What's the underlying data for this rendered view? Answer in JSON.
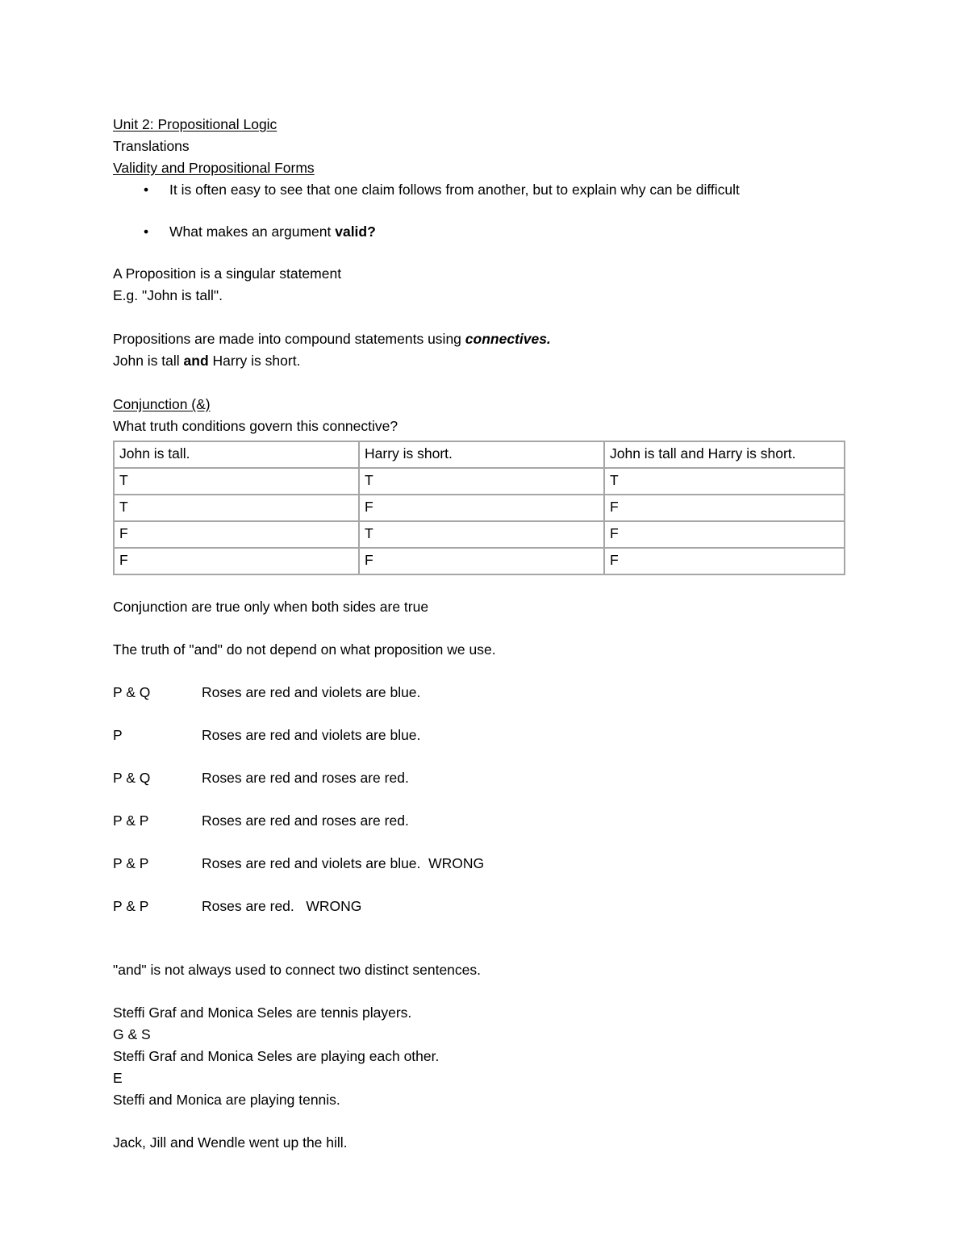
{
  "document": {
    "title": "Unit 2: Propositional Logic",
    "subtitle": "Translations",
    "section_heading": "Validity and Propositional Forms",
    "bullets": [
      {
        "marker": "•",
        "text": "It is often easy to see that one claim follows from another, but to explain why can be difficult"
      },
      {
        "marker": "•",
        "text_before": "What makes an argument ",
        "text_bold": "valid?",
        "text_after": ""
      }
    ],
    "proposition_block": {
      "line1": "A Proposition is a singular statement",
      "line2": "E.g. \"John is tall\"."
    },
    "connectives_block": {
      "line1_before": "Propositions are made into compound statements using ",
      "line1_bolditalic": "connectives.",
      "line2_before": "John is tall ",
      "line2_bold": "and",
      "line2_after": " Harry is short."
    },
    "conjunction": {
      "heading": "Conjunction (&)",
      "question": "What truth conditions govern this connective?",
      "table": {
        "headers": [
          "John is tall.",
          "Harry is short.",
          "John is tall and Harry is short."
        ],
        "rows": [
          [
            "T",
            "T",
            "T"
          ],
          [
            "T",
            "F",
            "F"
          ],
          [
            "F",
            "T",
            "F"
          ],
          [
            "F",
            "F",
            "F"
          ]
        ]
      },
      "note1": "Conjunction are true only when both sides are true",
      "note2": "The truth of \"and\" do not depend on what proposition we use."
    },
    "examples": [
      {
        "code": "P & Q",
        "text": "Roses are red and violets are blue."
      },
      {
        "code": "P",
        "text": "Roses are red and violets are blue."
      },
      {
        "code": "P & Q",
        "text": "Roses are red and roses are red."
      },
      {
        "code": "P & P",
        "text": "Roses are red and roses are red."
      },
      {
        "code": "P & P",
        "text": "Roses are red and violets are blue.  WRONG"
      },
      {
        "code": "P & P",
        "text": "Roses are red.   WRONG"
      }
    ],
    "closing": {
      "and_note": "\"and\" is not always used to connect two distinct sentences.",
      "tennis_lines": [
        "Steffi Graf and Monica Seles are tennis players.",
        "G & S",
        "Steffi Graf and Monica Seles are playing each other.",
        "E",
        "Steffi and Monica are playing tennis."
      ],
      "hill_line": "Jack, Jill and Wendle went up the hill."
    }
  }
}
